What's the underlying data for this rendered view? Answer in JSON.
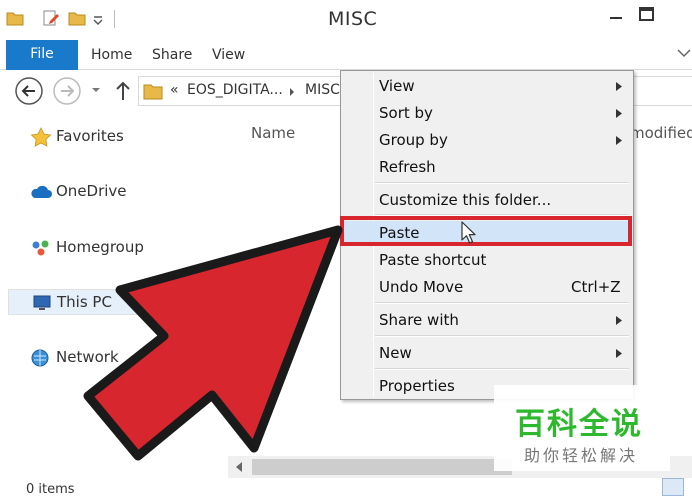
{
  "window": {
    "title": "MISC",
    "minimize_glyph": "_",
    "maximize_glyph": "□"
  },
  "ribbon": {
    "file_label": "File",
    "tabs": [
      "Home",
      "Share",
      "View"
    ]
  },
  "address": {
    "overflow": "«",
    "crumbs": [
      "EOS_DIGITA...",
      "MISC"
    ]
  },
  "navpane": {
    "items": [
      {
        "label": "Favorites",
        "icon": "star-icon"
      },
      {
        "label": "OneDrive",
        "icon": "cloud-icon"
      },
      {
        "label": "Homegroup",
        "icon": "homegroup-icon"
      },
      {
        "label": "This PC",
        "icon": "computer-icon",
        "selected": true
      },
      {
        "label": "Network",
        "icon": "network-icon"
      }
    ]
  },
  "content": {
    "columns": [
      "Name",
      "modified"
    ]
  },
  "status": {
    "items_text": "0 items"
  },
  "context_menu": {
    "items": [
      {
        "label": "View",
        "submenu": true
      },
      {
        "label": "Sort by",
        "submenu": true
      },
      {
        "label": "Group by",
        "submenu": true
      },
      {
        "label": "Refresh"
      },
      {
        "label": "Customize this folder..."
      },
      {
        "label": "Paste",
        "highlighted": true
      },
      {
        "label": "Paste shortcut"
      },
      {
        "label": "Undo Move",
        "shortcut": "Ctrl+Z"
      },
      {
        "label": "Share with",
        "submenu": true
      },
      {
        "label": "New",
        "submenu": true
      },
      {
        "label": "Properties"
      }
    ]
  },
  "colors": {
    "accent": "#1979ca",
    "highlight_border": "#d8262f",
    "arrow_fill": "#d8262f",
    "watermark_green": "#2db82d"
  },
  "watermark": {
    "title": "百科全说",
    "subtitle": "助你轻松解决"
  }
}
